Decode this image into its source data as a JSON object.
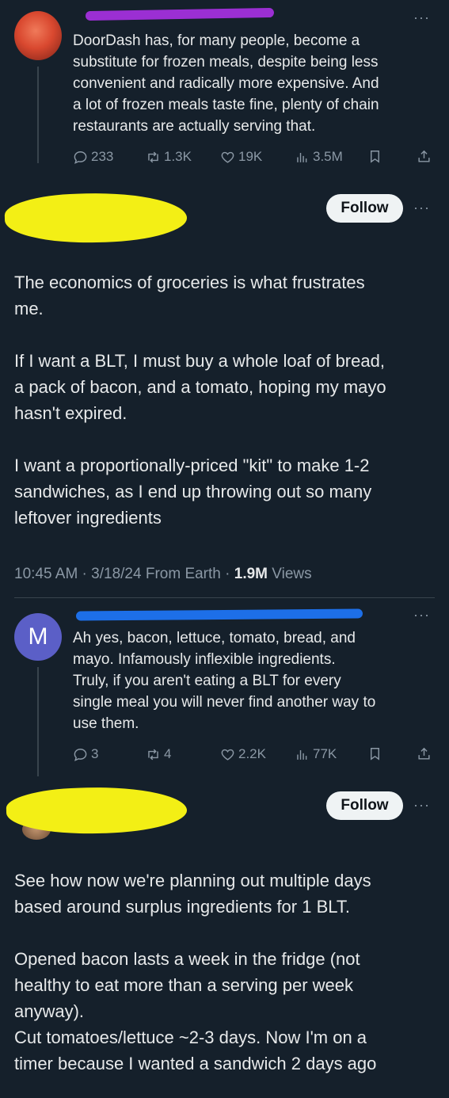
{
  "tweet1": {
    "text": "DoorDash has, for many people, become a substitute for frozen meals, despite being less convenient and radically more expensive. And a lot of frozen meals taste fine, plenty of chain restaurants are actually serving that.",
    "lines": [
      "DoorDash has, for many people, become a",
      "substitute for frozen meals, despite being less",
      "convenient and radically more expensive. And",
      "a lot of frozen meals taste fine, plenty of chain",
      "restaurants are actually serving that."
    ],
    "replies": "233",
    "reposts": "1.3K",
    "likes": "19K",
    "views": "3.5M"
  },
  "tweet2": {
    "follow_label": "Follow",
    "paragraphs": [
      [
        "The economics of groceries is what frustrates",
        "me."
      ],
      [
        "If I want a BLT, I must buy a whole loaf of bread,",
        "a pack of bacon, and a tomato, hoping my mayo",
        "hasn't expired."
      ],
      [
        "I want a proportionally-priced \"kit\" to make 1-2",
        "sandwiches, as I end up throwing out so many",
        "leftover ingredients"
      ]
    ],
    "time": "10:45 AM · 3/18/24 From Earth · ",
    "views_count": "1.9M",
    "views_label": " Views"
  },
  "tweet3": {
    "avatar_letter": "M",
    "lines": [
      "Ah yes, bacon,  lettuce, tomato, bread, and",
      "mayo. Infamously inflexible ingredients.",
      "Truly, if you aren't eating a BLT for every",
      "single meal you will never find another way to",
      "use them."
    ],
    "replies": "3",
    "reposts": "4",
    "likes": "2.2K",
    "views": "77K"
  },
  "tweet4": {
    "follow_label": "Follow",
    "paragraphs": [
      [
        "See how now we're planning out multiple days",
        "based around surplus ingredients for 1 BLT."
      ],
      [
        "Opened bacon lasts a week in the fridge (not",
        "healthy to eat more than a serving per week",
        "anyway).",
        "Cut tomatoes/lettuce ~2-3 days. Now I'm on a",
        "timer because I wanted a sandwich 2 days ago"
      ]
    ]
  },
  "colors": {
    "background": "#15202b",
    "text": "#e7e9ea",
    "muted": "#8b98a5",
    "avatar_m": "#5b5fc7"
  }
}
